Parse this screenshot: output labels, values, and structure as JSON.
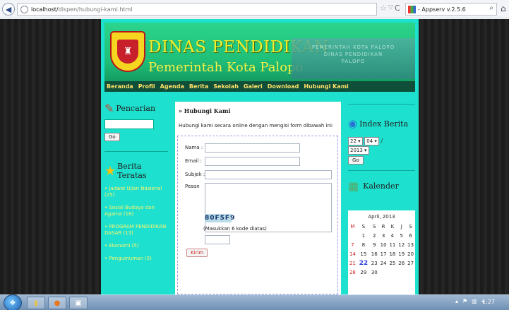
{
  "browser": {
    "url_host": "localhost/",
    "url_path": "dispen/hubungi-kami.html",
    "search_engine_label": "- Appserv v.2.5.6"
  },
  "site": {
    "title": "DINAS PENDIDIKAN",
    "subtitle": "Pemerintah Kota Palopo",
    "banner_text": [
      "PEMERINTAH KOTA PALOPO",
      "DINAS PENDIDIKAN",
      "PALOPO"
    ],
    "nav": [
      "Beranda",
      "Profil",
      "Agenda",
      "Berita",
      "Sekolah",
      "Galeri",
      "Download",
      "Hubungi Kami"
    ]
  },
  "left": {
    "search_title": "Pencarian",
    "search_button": "Go",
    "top_title": "Berita Teratas",
    "top_items": [
      {
        "label": "Jadwal Ujian Nasional",
        "count": "(25)"
      },
      {
        "label": "Sosial Budaya dan Agama",
        "count": "(18)"
      },
      {
        "label": "PROGRAM PENDIDIKAN DASAR",
        "count": "(13)"
      },
      {
        "label": "Ekonomi",
        "count": "(5)"
      },
      {
        "label": "Pengumuman",
        "count": "(5)"
      }
    ]
  },
  "main": {
    "heading": "» Hubungi Kami",
    "intro": "Hubungi kami secara online dengan mengisi form dibawah ini:",
    "labels": {
      "nama": "Nama  :",
      "email": "Email  :",
      "subjek": "Subjek :",
      "pesan": "Pesan"
    },
    "captcha": "80F5F9",
    "captcha_hint": "(Masukkan 6 kode diatas)",
    "submit": "Kirim"
  },
  "right": {
    "index_title": "Index Berita",
    "day": "22",
    "month": "04",
    "year": "2013",
    "go": "Go",
    "calendar_title": "Kalender",
    "calendar_month": "April, 2013",
    "weekdays": [
      "M",
      "S",
      "S",
      "R",
      "K",
      "J",
      "S"
    ],
    "weeks": [
      [
        "",
        "1",
        "2",
        "3",
        "4",
        "5",
        "6"
      ],
      [
        "7",
        "8",
        "9",
        "10",
        "11",
        "12",
        "13"
      ],
      [
        "14",
        "15",
        "16",
        "17",
        "18",
        "19",
        "20"
      ],
      [
        "21",
        "22",
        "23",
        "24",
        "25",
        "26",
        "27"
      ],
      [
        "28",
        "29",
        "30",
        "",
        "",
        "",
        ""
      ]
    ],
    "today": "22"
  },
  "taskbar": {
    "time": "1:27"
  },
  "colors": {
    "page_bg": "#1de0cf",
    "nav_text": "#ffe266",
    "sunday": "#d02020",
    "today": "#2a3fd8"
  }
}
